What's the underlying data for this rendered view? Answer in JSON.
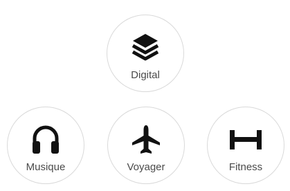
{
  "categories": [
    {
      "label": "Digital",
      "icon": "layers-icon"
    },
    {
      "label": "Musique",
      "icon": "headphones-icon"
    },
    {
      "label": "Voyager",
      "icon": "airplane-icon"
    },
    {
      "label": "Fitness",
      "icon": "dumbbell-icon"
    }
  ],
  "colors": {
    "icon": "#111111",
    "label": "#4a4a4a",
    "border": "#d9d9d9",
    "background": "#ffffff"
  }
}
